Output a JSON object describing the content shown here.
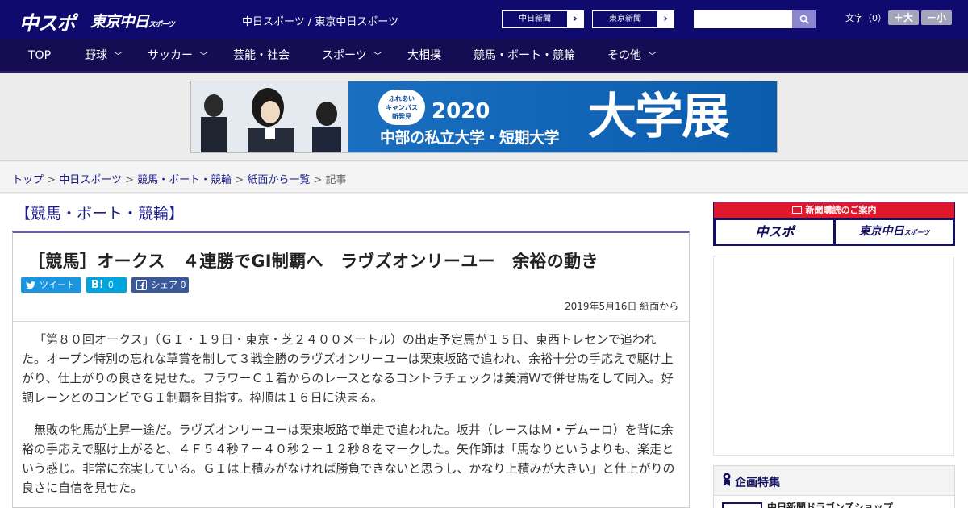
{
  "header": {
    "logo_main": "中スポ",
    "logo_tokyo": "東京中日",
    "logo_tokyo_small": "スポーツ",
    "site_names": "中日スポーツ / 東京中日スポーツ",
    "paper_buttons": [
      {
        "label": "中日新聞",
        "arrow": "›"
      },
      {
        "label": "東京新聞",
        "arrow": "›"
      }
    ],
    "search_placeholder": "",
    "font_label": "文字（0）",
    "font_up": "＋大",
    "font_down": "－小"
  },
  "nav": {
    "items": [
      {
        "label": "TOP",
        "dropdown": false
      },
      {
        "label": "野球",
        "dropdown": true
      },
      {
        "label": "サッカー",
        "dropdown": true
      },
      {
        "label": "芸能・社会",
        "dropdown": false
      },
      {
        "label": "スポーツ",
        "dropdown": true
      },
      {
        "label": "大相撲",
        "dropdown": false
      },
      {
        "label": "競馬・ボート・競輪",
        "dropdown": false
      },
      {
        "label": "その他",
        "dropdown": true
      }
    ],
    "chevron": "﹀"
  },
  "banner": {
    "badge": "ふれあい\nキャンパス\n新発見",
    "year": "2020",
    "subtitle": "中部の私立大学・短期大学",
    "big_text": "大学展"
  },
  "breadcrumb": {
    "items": [
      "トップ",
      "中日スポーツ",
      "競馬・ボート・競輪",
      "紙面から一覧"
    ],
    "current": "記事",
    "separator": ">"
  },
  "article": {
    "category": "【競馬・ボート・競輪】",
    "title": "［競馬］オークス　４連勝でGI制覇へ　ラヴズオンリーユー　余裕の動き",
    "share": {
      "tweet": "ツイート",
      "hatena_count": "0",
      "facebook": "シェア",
      "facebook_count": "0"
    },
    "date": "2019年5月16日 紙面から",
    "paragraphs": [
      "「第８０回オークス」（ＧＩ・１９日・東京・芝２４００メートル）の出走予定馬が１５日、東西トレセンで追われた。オープン特別の忘れな草賞を制して３戦全勝のラヴズオンリーユーは栗東坂路で追われ、余裕十分の手応えで駆け上がり、仕上がりの良さを見せた。フラワーＣ１着からのレースとなるコントラチェックは美浦Ｗで併せ馬をして同入。好調レーンとのコンビでＧＩ制覇を目指す。枠順は１６日に決まる。",
      "無敗の牝馬が上昇一途だ。ラヴズオンリーユーは栗東坂路で単走で追われた。坂井（レースはＭ・デムーロ）を背に余裕の手応えで駆け上がると、４Ｆ５４秒７－４０秒２－１２秒８をマークした。矢作師は「馬なりというよりも、楽走という感じ。非常に充実している。ＧＩは上積みがなければ勝負できないと思うし、かなり上積みが大きい」と仕上がりの良さに自信を見せた。"
    ]
  },
  "sidebar": {
    "subscription_head": "新聞購読のご案内",
    "subscription_logos": [
      "中スポ",
      "東京中日"
    ],
    "subscription_logo_small": "スポーツ",
    "feature_title": "企画特集",
    "feature_item": "中日新聞ドラゴンズショップ"
  },
  "colors": {
    "header_bg": "#0e0a6e",
    "nav_bg": "#150c52",
    "accent_red": "#e0182c",
    "link": "#1d1d8a",
    "tweet": "#1b95e0",
    "hatena": "#00a4de",
    "facebook": "#3b5998"
  }
}
